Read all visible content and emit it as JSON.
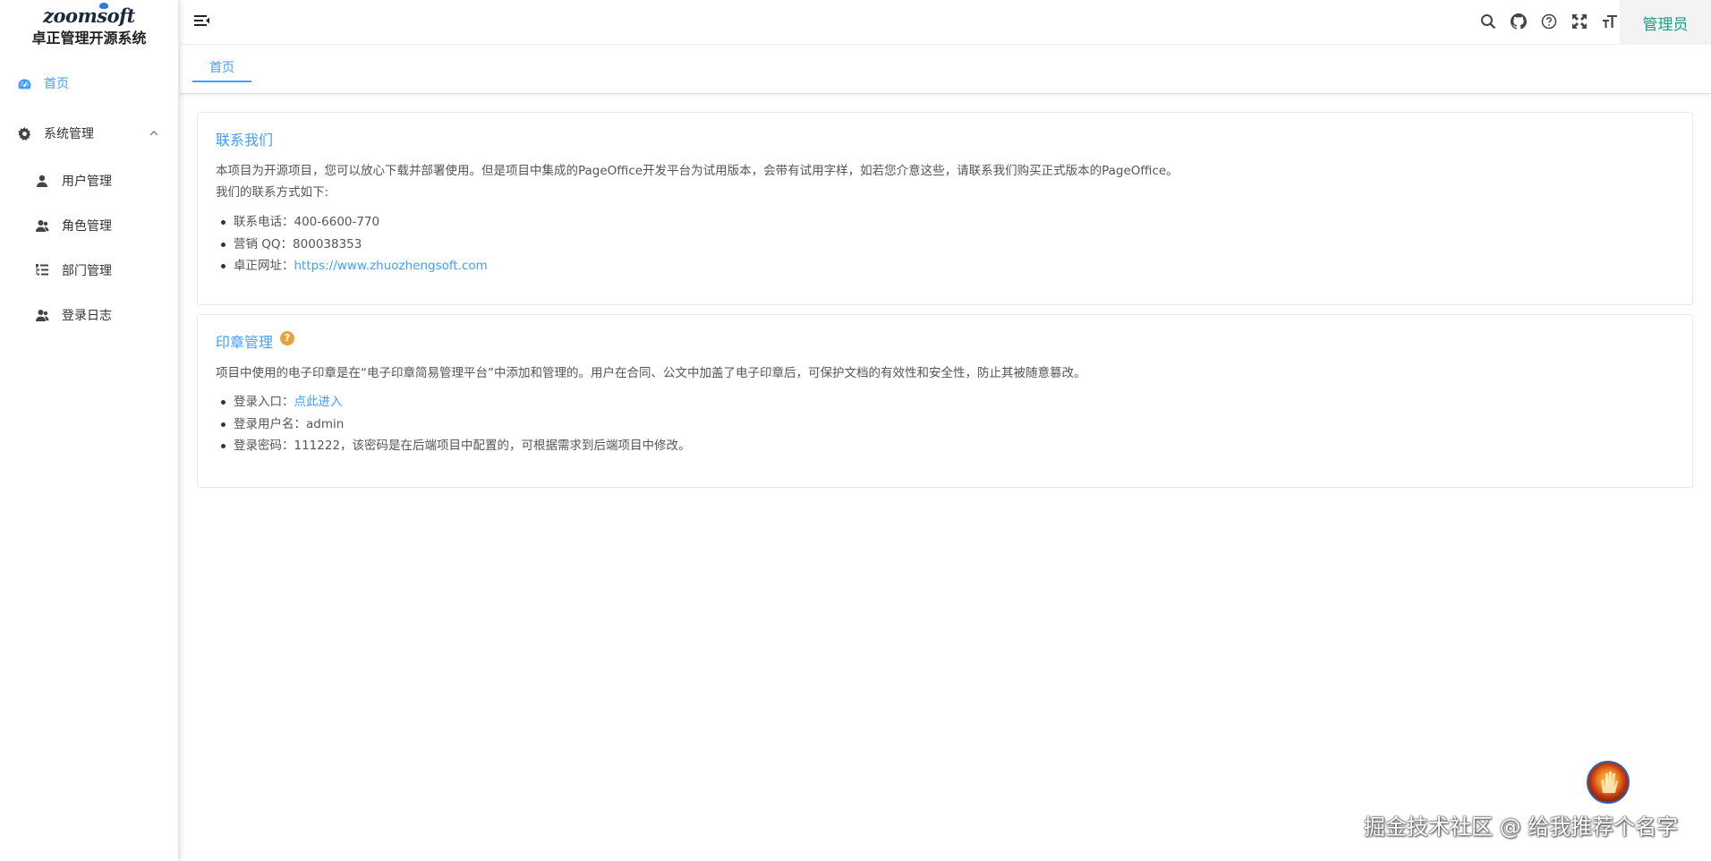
{
  "app": {
    "logo_text": "zoomsoft",
    "system_title": "卓正管理开源系统"
  },
  "sidebar": {
    "items": [
      {
        "label": "首页",
        "icon": "dashboard-icon",
        "active": true
      },
      {
        "label": "系统管理",
        "icon": "gear-icon",
        "expanded": true
      },
      {
        "label": "用户管理",
        "icon": "user-icon"
      },
      {
        "label": "角色管理",
        "icon": "users-icon"
      },
      {
        "label": "部门管理",
        "icon": "tree-list-icon"
      },
      {
        "label": "登录日志",
        "icon": "users-log-icon"
      }
    ]
  },
  "header": {
    "toggle_icon": "menu-fold-icon",
    "icons": [
      "search-icon",
      "github-icon",
      "help-circle-icon",
      "fullscreen-icon",
      "font-size-icon"
    ],
    "user_label": "管理员"
  },
  "tabs": [
    {
      "label": "首页",
      "active": true
    }
  ],
  "contact_card": {
    "title": "联系我们",
    "intro": "本项目为开源项目，您可以放心下载并部署使用。但是项目中集成的PageOffice开发平台为试用版本，会带有试用字样，如若您介意这些，请联系我们购买正式版本的PageOffice。",
    "subtitle": "我们的联系方式如下:",
    "items": [
      {
        "label": "联系电话：",
        "value": "400-6600-770"
      },
      {
        "label": "营销 QQ：",
        "value": "800038353"
      },
      {
        "label": "卓正网址：",
        "value": "https://www.zhuozhengsoft.com"
      }
    ]
  },
  "seal_card": {
    "title": "印章管理",
    "help_badge": "?",
    "intro": "项目中使用的电子印章是在“电子印章简易管理平台”中添加和管理的。用户在合同、公文中加盖了电子印章后，可保护文档的有效性和安全性，防止其被随意篡改。",
    "items": [
      {
        "label": "登录入口：",
        "value": "点此进入"
      },
      {
        "label": "登录用户名：",
        "value": "admin"
      },
      {
        "label": "登录密码：",
        "value": "111222，该密码是在后端项目中配置的，可根据需求到后端项目中修改。"
      }
    ]
  },
  "watermark": "掘金技术社区 @ 给我推荐个名字",
  "colors": {
    "accent": "#409eff",
    "admin_text": "#16a085",
    "badge": "#e6a23c"
  }
}
